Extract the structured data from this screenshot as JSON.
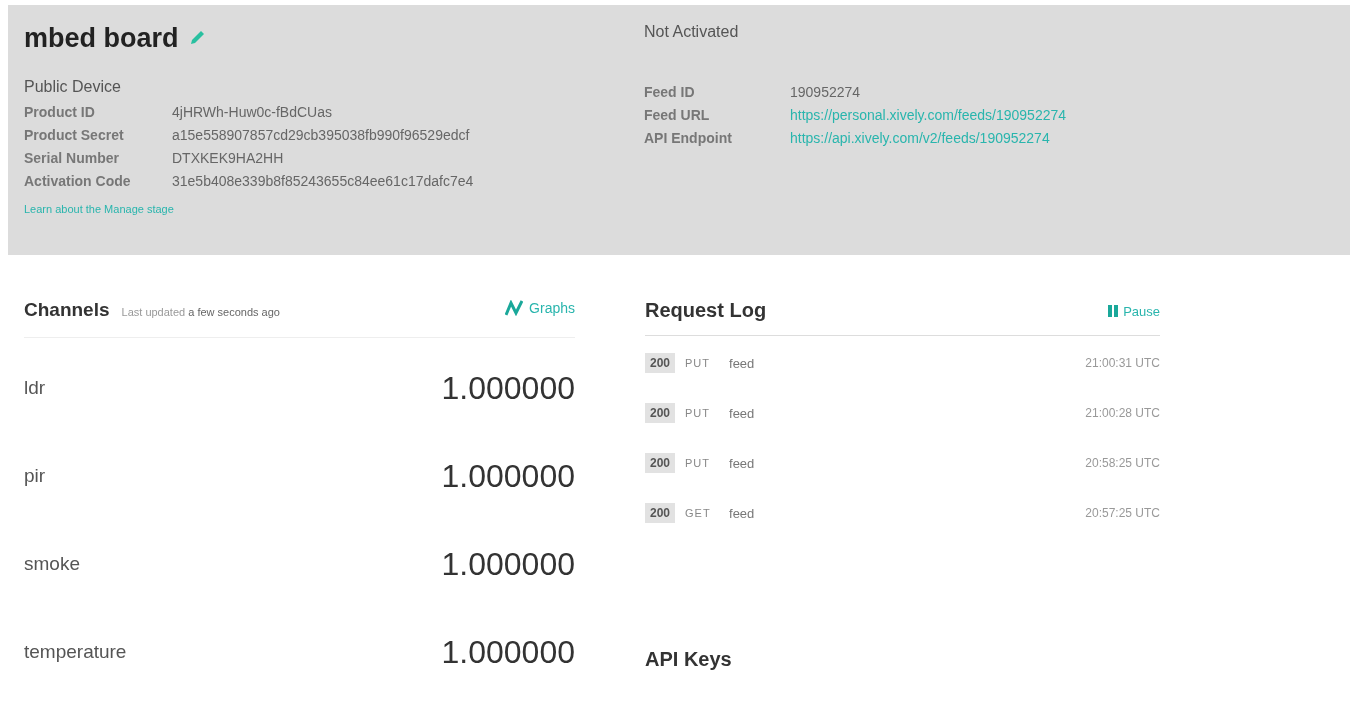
{
  "device": {
    "title": "mbed board",
    "visibility": "Public Device",
    "fields": [
      {
        "label": "Product ID",
        "value": "4jHRWh-Huw0c-fBdCUas"
      },
      {
        "label": "Product Secret",
        "value": "a15e558907857cd29cb395038fb990f96529edcf"
      },
      {
        "label": "Serial Number",
        "value": "DTXKEK9HA2HH"
      },
      {
        "label": "Activation Code",
        "value": "31e5b408e339b8f85243655c84ee61c17dafc7e4"
      }
    ],
    "learn_link": "Learn about the Manage stage",
    "status": "Not Activated",
    "feed_fields": [
      {
        "label": "Feed ID",
        "value": "190952274",
        "kind": "text"
      },
      {
        "label": "Feed URL",
        "value": "https://personal.xively.com/feeds/190952274",
        "kind": "link"
      },
      {
        "label": "API Endpoint",
        "value": "https://api.xively.com/v2/feeds/190952274",
        "kind": "link"
      }
    ]
  },
  "channels": {
    "title": "Channels",
    "updated_prefix": "Last updated",
    "updated_time": "a few seconds ago",
    "graphs_button": "Graphs",
    "items": [
      {
        "name": "ldr",
        "value": "1.000000"
      },
      {
        "name": "pir",
        "value": "1.000000"
      },
      {
        "name": "smoke",
        "value": "1.000000"
      },
      {
        "name": "temperature",
        "value": "1.000000"
      }
    ]
  },
  "request_log": {
    "title": "Request Log",
    "pause_button": "Pause",
    "entries": [
      {
        "status": "200",
        "method": "PUT",
        "resource": "feed",
        "time": "21:00:31 UTC"
      },
      {
        "status": "200",
        "method": "PUT",
        "resource": "feed",
        "time": "21:00:28 UTC"
      },
      {
        "status": "200",
        "method": "PUT",
        "resource": "feed",
        "time": "20:58:25 UTC"
      },
      {
        "status": "200",
        "method": "GET",
        "resource": "feed",
        "time": "20:57:25 UTC"
      }
    ]
  },
  "api_keys": {
    "title": "API Keys"
  }
}
